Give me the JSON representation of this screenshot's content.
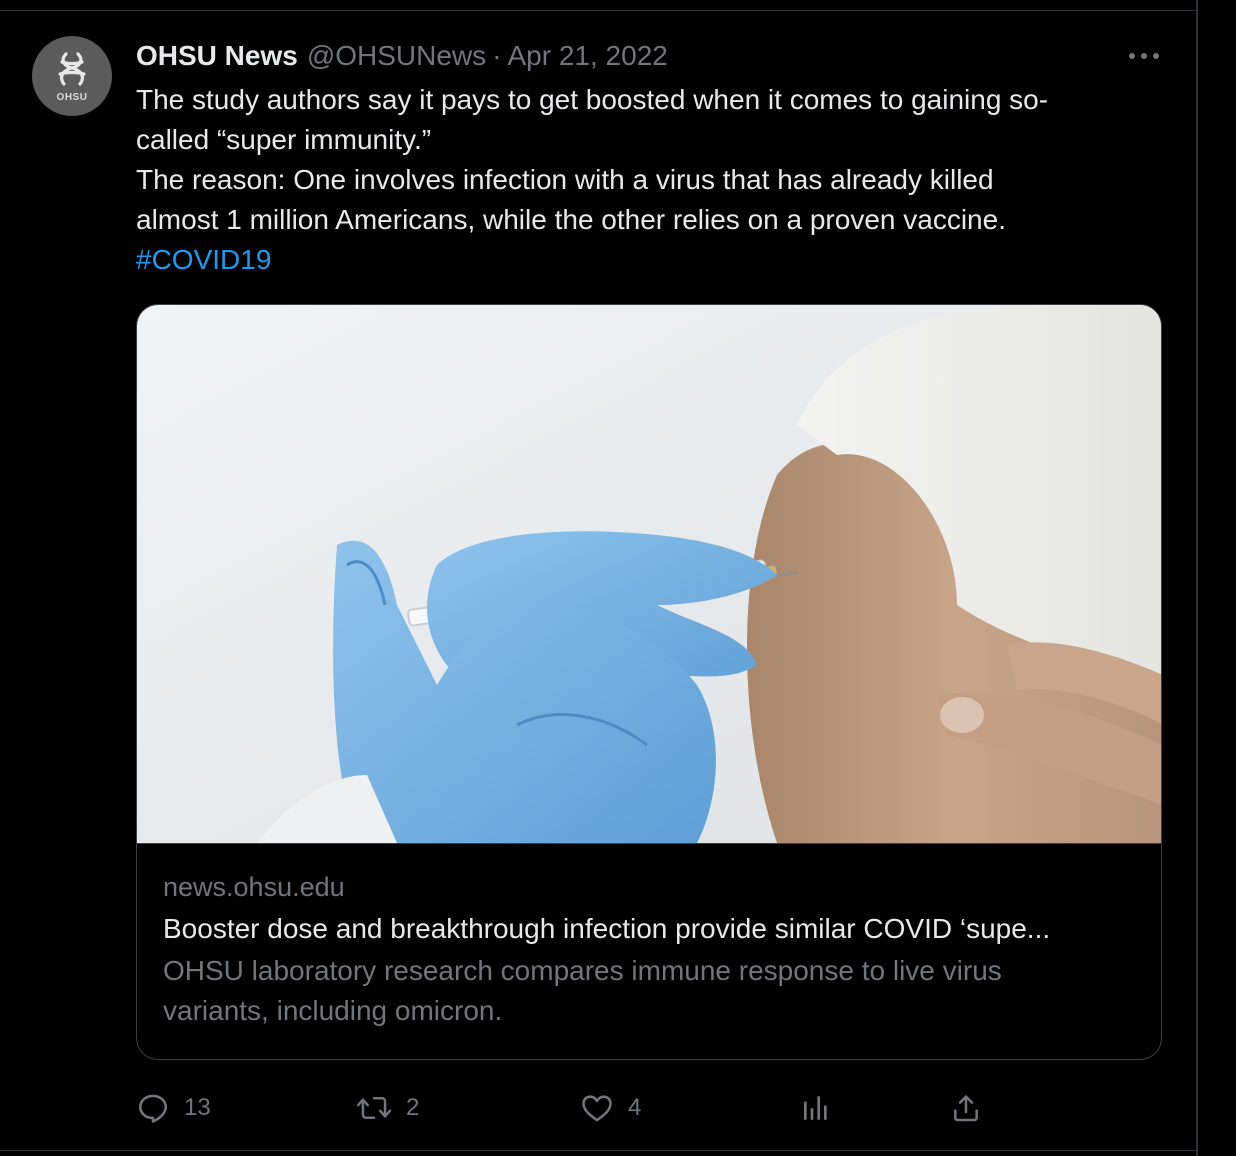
{
  "tweet": {
    "avatar_text": "OHSU",
    "author_name": "OHSU News",
    "handle": "@OHSUNews",
    "separator": "·",
    "timestamp": "Apr 21, 2022",
    "text_lines": [
      "The study authors say it pays to get boosted when it comes to gaining so-",
      "called “super immunity.”",
      "The reason: One involves infection with a virus that has already killed",
      "almost 1 million Americans, while the other relies on a proven vaccine."
    ],
    "hashtag": "#COVID19"
  },
  "card": {
    "domain": "news.ohsu.edu",
    "title": "Booster dose and breakthrough infection provide similar COVID ‘supe...",
    "description_lines": [
      "OHSU laboratory research compares immune response to live virus",
      "variants, including omicron."
    ]
  },
  "actions": {
    "reply_count": "13",
    "retweet_count": "2",
    "like_count": "4"
  },
  "colors": {
    "background": "#000000",
    "text_primary": "#e7e9ea",
    "text_secondary": "#71767b",
    "link": "#1d9bf0",
    "border": "#2f3336"
  },
  "icons": [
    "ohsu-logo-icon",
    "more-icon",
    "reply-icon",
    "retweet-icon",
    "like-icon",
    "views-icon",
    "share-icon"
  ]
}
